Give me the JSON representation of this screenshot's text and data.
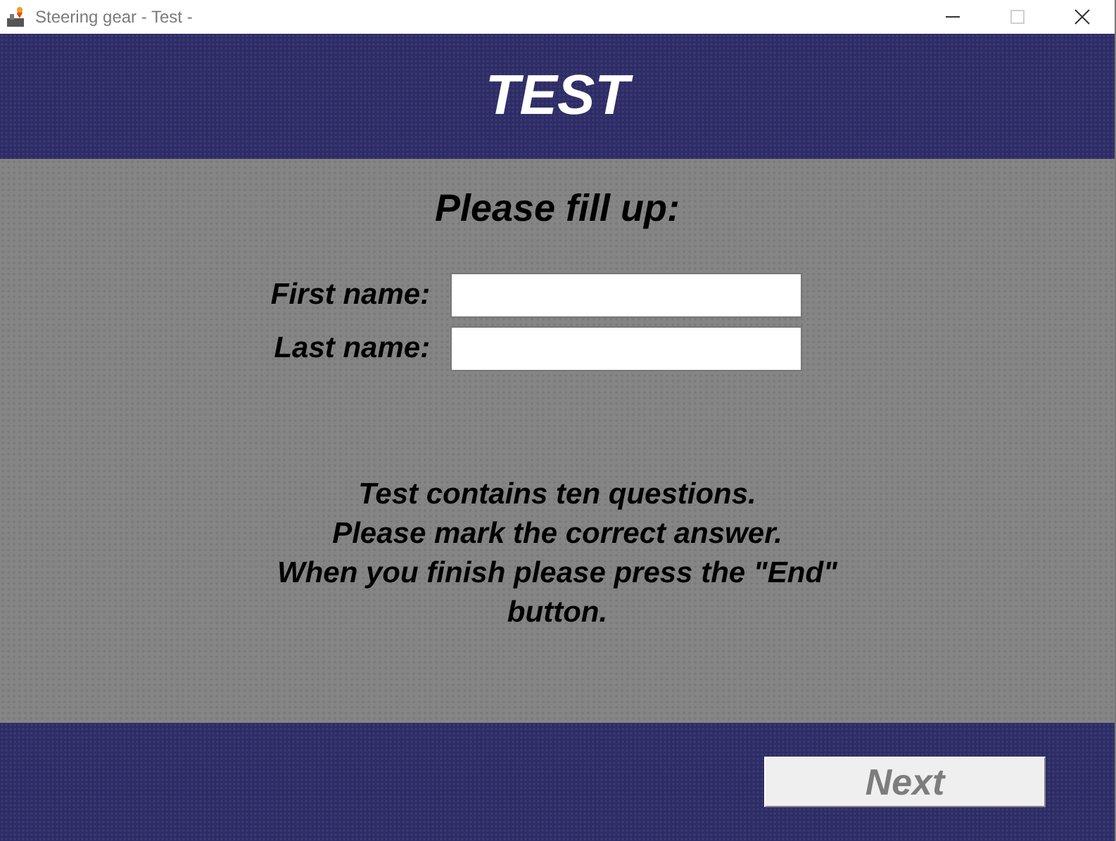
{
  "window": {
    "title": "Steering gear - Test -",
    "maximize_disabled": true
  },
  "header": {
    "title": "TEST"
  },
  "form": {
    "heading": "Please fill up:",
    "fields": [
      {
        "label": "First name:"
      },
      {
        "label": "Last name:"
      }
    ]
  },
  "instructions": [
    "Test contains ten questions.",
    "Please mark the correct answer.",
    "When you finish please press the \"End\"",
    "button."
  ],
  "footer": {
    "next_button": {
      "label": "Next",
      "disabled": true
    }
  }
}
